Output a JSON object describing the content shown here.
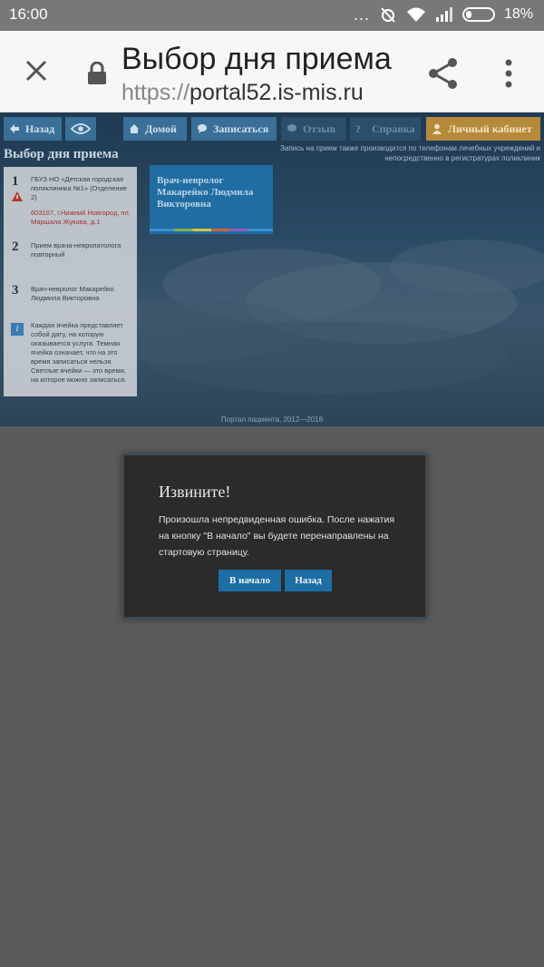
{
  "status_bar": {
    "time": "16:00",
    "dots": "...",
    "battery": "18%"
  },
  "browser": {
    "page_title": "Выбор дня приема",
    "url_protocol": "https://",
    "url_host": "portal52.is-mis.ru"
  },
  "nav": {
    "back": "Назад",
    "home": "Домой",
    "signup": "Записаться",
    "review": "Отзыв",
    "help": "Справка",
    "cabinet": "Личный кабинет"
  },
  "main": {
    "heading": "Выбор дня приема",
    "note": "Запись на прием также производится по телефонам лечебных учреждений и непосредственно в регистратурах поликлиник"
  },
  "steps": [
    {
      "number": "1",
      "text": "ГБУЗ НО «Детская городская поликлиника №1» (Отделение 2)",
      "address": "603107, г.Нижний Новгород, пл. Маршала Жукова, д.1"
    },
    {
      "number": "2",
      "text": "Прием врача-невропатолога повторный"
    },
    {
      "number": "3",
      "text": "Врач-невролог Макарейко Людмила Викторовна"
    }
  ],
  "info_text": "Каждая ячейка представляет собой дату, на которую оказывается услуга. Темная ячейка означает, что на это время записаться нельзя. Светлые ячейки — это время, на которое можно записаться.",
  "doctor_card": {
    "name": "Врач-невролог Макарейко Людмила Викторовна"
  },
  "footer": "Портал пациента, 2012—2018",
  "modal": {
    "title": "Извините!",
    "text": "Произошла непредвиденная ошибка. После нажатия на кнопку \"В начало\" вы будете перенаправлены на стартовую страницу.",
    "start_button": "В начало",
    "back_button": "Назад"
  },
  "colors": {
    "accent": "#1d6ea5",
    "cabinet": "#b58a3a",
    "overlay": "#5a5a5a"
  }
}
